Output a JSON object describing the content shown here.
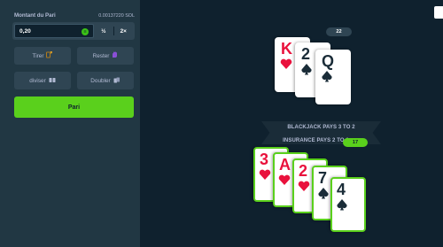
{
  "sidebar": {
    "bet_label": "Montant du Pari",
    "balance": "0.00137220 SOL",
    "amount_value": "0,20",
    "currency_icon": "solana-coin-icon",
    "half_label": "½",
    "double_label": "2×",
    "hit_label": "Tirer",
    "stand_label": "Rester",
    "split_label": "diviser",
    "double_down_label": "Doubler",
    "bet_button_label": "Pari",
    "accent_color": "#5ad01c"
  },
  "table": {
    "dealer_total": "22",
    "player_total": "17",
    "banner_line1": "BLACKJACK PAYS 3 TO 2",
    "banner_line2": "INSURANCE PAYS 2 TO 1",
    "dealer_cards": [
      {
        "rank": "K",
        "suit": "hearts"
      },
      {
        "rank": "2",
        "suit": "spades"
      },
      {
        "rank": "Q",
        "suit": "spades"
      }
    ],
    "player_cards": [
      {
        "rank": "3",
        "suit": "hearts"
      },
      {
        "rank": "A",
        "suit": "hearts"
      },
      {
        "rank": "2",
        "suit": "hearts"
      },
      {
        "rank": "7",
        "suit": "spades"
      },
      {
        "rank": "4",
        "suit": "spades"
      }
    ]
  }
}
